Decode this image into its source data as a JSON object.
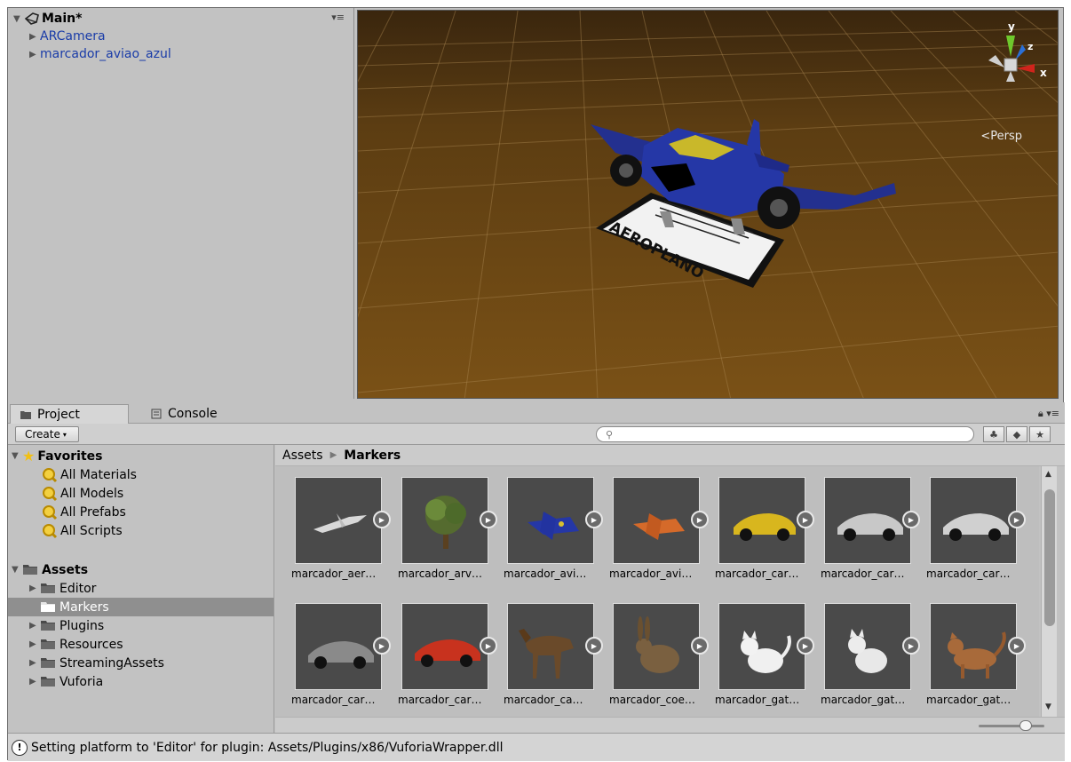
{
  "hierarchy": {
    "scene_name": "Main*",
    "items": [
      {
        "label": "ARCamera"
      },
      {
        "label": "marcador_aviao_azul"
      }
    ]
  },
  "scene_view": {
    "projection_label": "Persp",
    "gizmo_axes": {
      "x": "x",
      "y": "y",
      "z": "z"
    },
    "marker_text": "AEROPLANO"
  },
  "tabs": {
    "project": "Project",
    "console": "Console"
  },
  "toolbar": {
    "create_label": "Create"
  },
  "favorites": {
    "label": "Favorites",
    "items": [
      {
        "label": "All Materials"
      },
      {
        "label": "All Models"
      },
      {
        "label": "All Prefabs"
      },
      {
        "label": "All Scripts"
      }
    ]
  },
  "assets_tree": {
    "label": "Assets",
    "folders": [
      {
        "label": "Editor"
      },
      {
        "label": "Markers"
      },
      {
        "label": "Plugins"
      },
      {
        "label": "Resources"
      },
      {
        "label": "StreamingAssets"
      },
      {
        "label": "Vuforia"
      }
    ]
  },
  "breadcrumb": {
    "root": "Assets",
    "current": "Markers"
  },
  "assets_grid": [
    {
      "label": "marcador_aer…",
      "thumb": "white-plane"
    },
    {
      "label": "marcador_arv…",
      "thumb": "tree"
    },
    {
      "label": "marcador_avi…",
      "thumb": "blue-plane"
    },
    {
      "label": "marcador_avi…",
      "thumb": "orange-plane"
    },
    {
      "label": "marcador_car…",
      "thumb": "yellow-car"
    },
    {
      "label": "marcador_car…",
      "thumb": "silver-car"
    },
    {
      "label": "marcador_car…",
      "thumb": "silver-car-2"
    },
    {
      "label": "marcador_car…",
      "thumb": "grey-car"
    },
    {
      "label": "marcador_car…",
      "thumb": "red-car"
    },
    {
      "label": "marcador_ca…",
      "thumb": "horse"
    },
    {
      "label": "marcador_coe…",
      "thumb": "rabbit"
    },
    {
      "label": "marcador_gat…",
      "thumb": "white-cat"
    },
    {
      "label": "marcador_gat…",
      "thumb": "white-cat-2"
    },
    {
      "label": "marcador_gat…",
      "thumb": "tabby-cat"
    }
  ],
  "status": {
    "message": "Setting platform to 'Editor' for plugin: Assets/Plugins/x86/VuforiaWrapper.dll"
  }
}
